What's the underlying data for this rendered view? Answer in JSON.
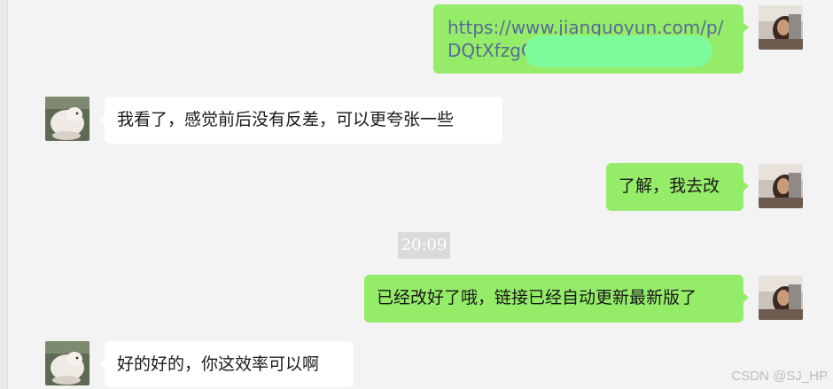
{
  "messages": [
    {
      "side": "out",
      "lines": [
        "https://www.jianguoyun.com/p/",
        "DQtXfzgC"
      ]
    },
    {
      "side": "in",
      "text": "我看了，感觉前后没有反差，可以更夸张一些"
    },
    {
      "side": "out",
      "text": "了解，我去改"
    },
    {
      "side": "out",
      "text": "已经改好了哦，链接已经自动更新最新版了"
    },
    {
      "side": "in",
      "text": "好的好的，你这效率可以啊"
    }
  ],
  "timestamp": "20:09",
  "watermark": "CSDN @SJ_HP",
  "colors": {
    "chat_bg": "#f3f3f3",
    "outgoing_bubble": "#95ec69",
    "incoming_bubble": "#ffffff",
    "link": "#576b95",
    "redaction": "#7dfb9a",
    "timestamp_bg": "#dadada"
  },
  "icons": {
    "self_avatar": "person-photo-avatar",
    "contact_avatar": "lamb-photo-avatar"
  }
}
